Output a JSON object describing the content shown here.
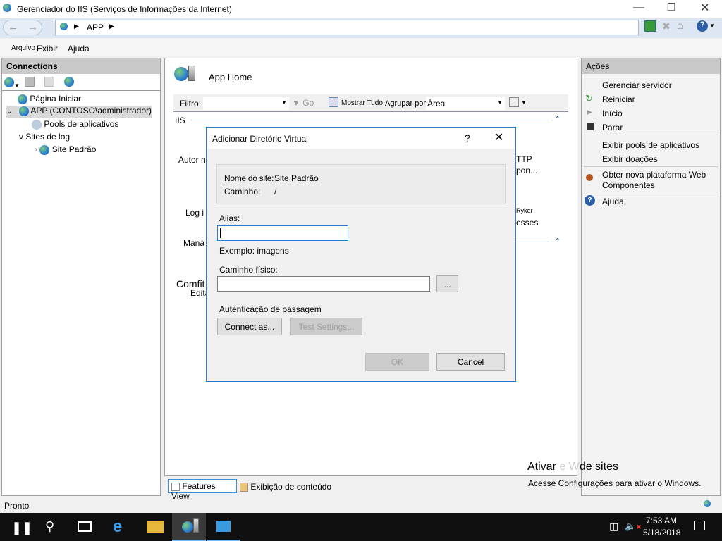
{
  "window": {
    "title": "Gerenciador do IIS (Serviços de Informações da Internet)"
  },
  "address": {
    "segments": [
      "APP"
    ]
  },
  "menu": [
    "Arquivo",
    "Exibir",
    "Ajuda"
  ],
  "connections": {
    "title": "Connections",
    "tree": [
      {
        "label": "Página Iniciar"
      },
      {
        "label": "APP (CONTOSO\\administrador)"
      },
      {
        "label": "Pools de aplicativos"
      },
      {
        "label": "v Sites de log"
      },
      {
        "label": "Site Padrão"
      }
    ]
  },
  "center": {
    "title": "App Home",
    "filter": {
      "label": "Filtro:",
      "value": "",
      "go": "Go",
      "show_all": "Mostrar Tudo",
      "group_by": "Agrupar por:",
      "group_value": "Área"
    },
    "groups": [
      "IIS",
      "Maná g"
    ],
    "icons": [
      "Autor n",
      "Log i",
      "Comfit",
      "Editar",
      "TTP",
      "pon...",
      "Ryker",
      "esses"
    ]
  },
  "dialog": {
    "title": "Adicionar Diretório Virtual",
    "help": "?",
    "site_label": "Nome do site:",
    "site_value": "Site Padrão",
    "path_label": "Caminho:",
    "path_value": "/",
    "alias_label": "Alias:",
    "alias_value": "",
    "example": "Exemplo: imagens",
    "physical_label": "Caminho físico:",
    "physical_value": "",
    "browse": "...",
    "auth_label": "Autenticação de passagem",
    "connect_as": "Connect as...",
    "test_settings": "Test Settings...",
    "ok": "OK",
    "cancel": "Cancel"
  },
  "actions": {
    "title": "Ações",
    "items": [
      "Gerenciar servidor",
      "Reiniciar",
      "Início",
      "Parar",
      "Exibir pools de aplicativos",
      "Exibir doações",
      "Obter nova plataforma Web",
      "Componentes",
      "Ajuda"
    ]
  },
  "tabs": {
    "features": "Features View",
    "content": "Exibição de conteúdo"
  },
  "watermark": {
    "line1a": "Ativar",
    "line1b": "e W",
    "line1c": "de sites",
    "line2": "Acesse Configurações para ativar o Windows."
  },
  "status": "Pronto",
  "taskbar": {
    "time": "7:53 AM",
    "date": "5/18/2018"
  }
}
